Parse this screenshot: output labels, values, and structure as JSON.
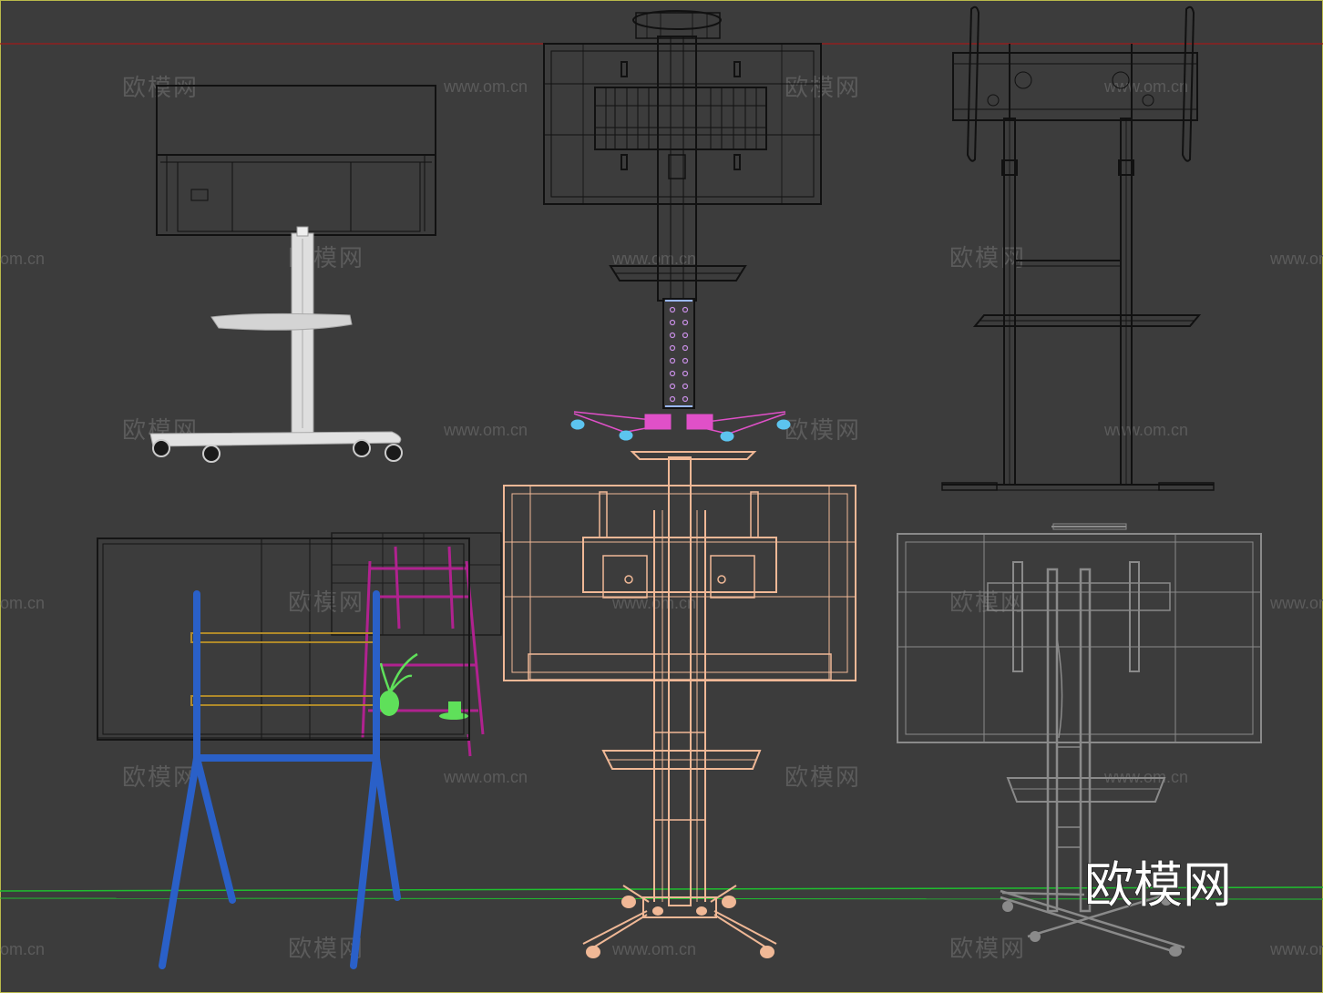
{
  "viewport": {
    "background": "#3c3c3c",
    "x_axis_color": "#a01818",
    "ground_color": "#1fbf2f",
    "frame_color": "#b9b94a"
  },
  "watermark": {
    "brand": "欧模网",
    "url": "www.om.cn",
    "url_partial": "om.cn",
    "big_logo": "欧模网"
  },
  "models": [
    {
      "name": "white-mobile-tv-cart",
      "color": "#d9d9d9"
    },
    {
      "name": "black-wireframe-cart-with-tray",
      "color": "#111111"
    },
    {
      "name": "black-double-pole-floor-stand",
      "color": "#111111"
    },
    {
      "name": "blue-easel-whiteboard-stand",
      "color": "#2a60c8"
    },
    {
      "name": "magenta-side-cart",
      "color": "#b0228f"
    },
    {
      "name": "peach-tv-trolley",
      "color": "#f0b896"
    },
    {
      "name": "gray-tv-floor-stand",
      "color": "#8a8a8a"
    }
  ]
}
